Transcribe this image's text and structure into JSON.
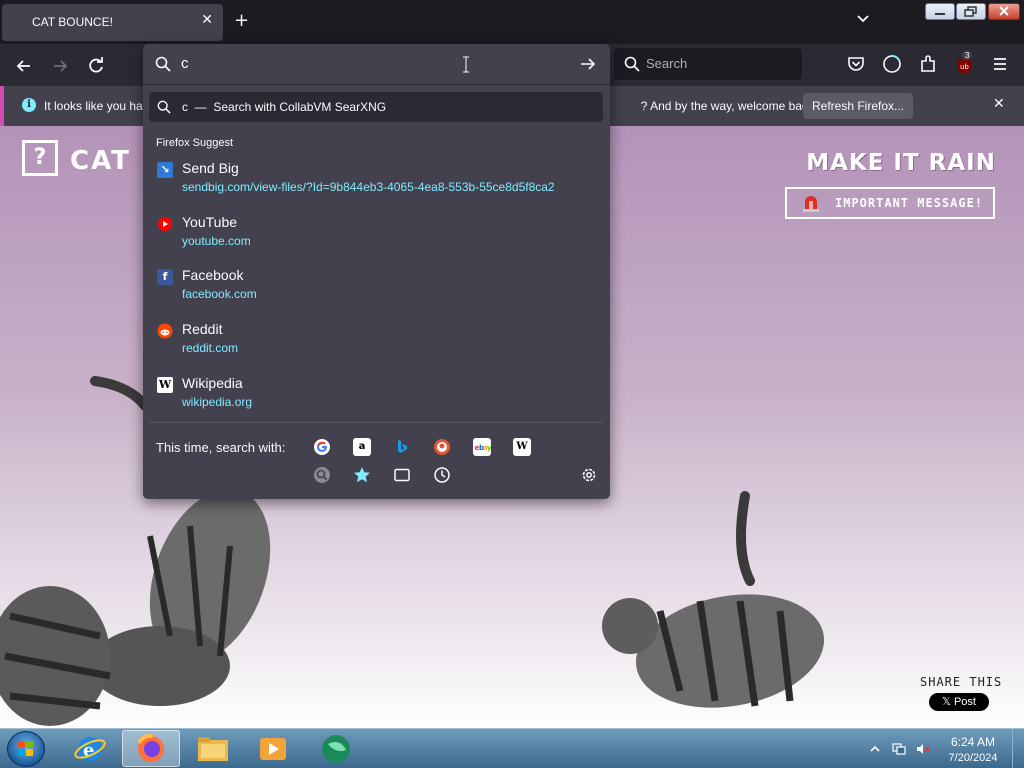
{
  "browser": {
    "tab_title": "CAT BOUNCE!",
    "tab_close": "✕",
    "new_tab": "+",
    "search_box_placeholder": "Search",
    "extension_badge": "3"
  },
  "notification": {
    "text_before": "It looks like you ha",
    "text_after": "? And by the way, welcome back!",
    "refresh_button": "Refresh Firefox...",
    "close": "✕"
  },
  "urlbar": {
    "input_value": "c",
    "search_row_text": "c  —  Search with CollabVM SearXNG",
    "suggest_heading": "Firefox Suggest",
    "suggestions": [
      {
        "title": "Send Big",
        "url": "sendbig.com/view-files/?Id=9b844eb3-4065-4ea8-553b-55ce8d5f8ca2",
        "icon": "sendbig-icon",
        "icon_color": "#2d7bd6"
      },
      {
        "title": "YouTube",
        "url": "youtube.com",
        "icon": "youtube-icon",
        "icon_color": "#ff0000"
      },
      {
        "title": "Facebook",
        "url": "facebook.com",
        "icon": "facebook-icon",
        "icon_color": "#3b5998"
      },
      {
        "title": "Reddit",
        "url": "reddit.com",
        "icon": "reddit-icon",
        "icon_color": "#ff4500"
      },
      {
        "title": "Wikipedia",
        "url": "wikipedia.org",
        "icon": "wikipedia-icon",
        "icon_color": "#ffffff"
      }
    ],
    "search_with_label": "This time, search with:",
    "engines": [
      "google-icon",
      "amazon-icon",
      "bing-icon",
      "duckduckgo-icon",
      "ebay-icon",
      "wikipedia-icon"
    ],
    "modes": [
      "searx-icon",
      "bookmarks-icon",
      "tabs-icon",
      "history-icon"
    ]
  },
  "page": {
    "logo_mark": "?",
    "logo_text": "CAT B",
    "make_it_rain": "MAKE IT RAIN",
    "important_message": "IMPORTANT MESSAGE!",
    "share_this": "SHARE THIS",
    "x_post": "𝕏 Post"
  },
  "taskbar": {
    "time": "6:24 AM",
    "date": "7/20/2024"
  },
  "colors": {
    "accent": "#80ebff",
    "panel": "#42414d",
    "toolbar": "#2b2a33",
    "notification_stripe": "#d44cae"
  }
}
